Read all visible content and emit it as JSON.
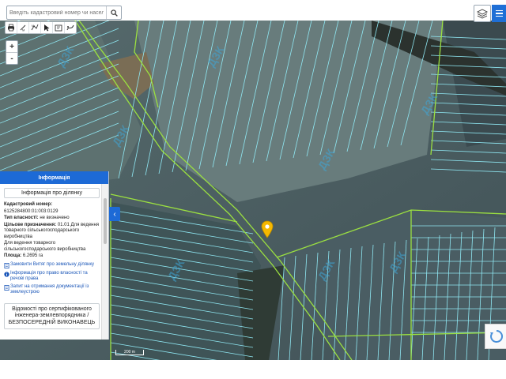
{
  "search": {
    "placeholder": "Введіть кадастровий номер чи населе"
  },
  "toolbar": {
    "tools": [
      "print-icon",
      "ruler-icon",
      "measure-area-icon",
      "pointer-icon",
      "export-icon",
      "draw-icon"
    ]
  },
  "zoom": {
    "in_label": "+",
    "out_label": "-"
  },
  "panel": {
    "header": "Інформація",
    "title": "Інформація про ділянку",
    "cadastral_label": "Кадастровий номер:",
    "cadastral_value": "6125284800:01:003:0129",
    "ownership_label": "Тип власності:",
    "ownership_value": "не визначено",
    "purpose_label": "Цільове призначення:",
    "purpose_value": "01.01 Для ведення товарного сільськогосподарського виробництва",
    "purpose_value2": "Для ведення товарного сільськогосподарського виробництва",
    "area_label": "Площа:",
    "area_value": "6.2695 га",
    "links": [
      "Замовити Витяг про земельну ділянку",
      "Інформація про право власності та речові права",
      "Запит на отримання документації із землеустрою"
    ],
    "cert_text": "Відомості про сертифікованого інженера-землевпорядника / БЕЗПОСЕРЕДНІЙ ВИКОНАВЕЦЬ"
  },
  "scale": {
    "label": "200 m"
  },
  "map": {
    "watermark": "ДЗК",
    "colors": {
      "parcel": "#8fe7f2",
      "boundary": "#9be040",
      "pin": "#f5b800",
      "panel_header": "#1d6ad6"
    }
  }
}
